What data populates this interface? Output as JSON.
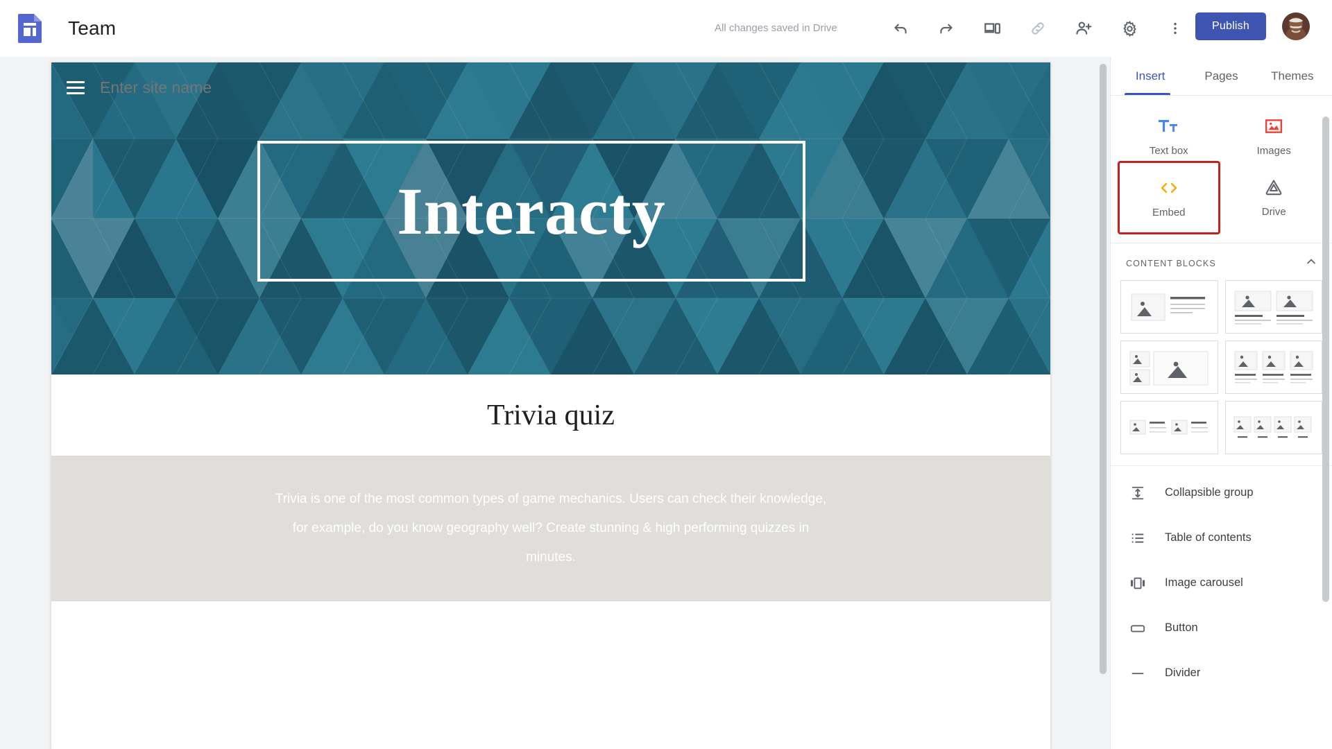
{
  "topbar": {
    "logo_icon": "google-sites-logo-icon",
    "doc_title": "Team",
    "save_status": "All changes saved in Drive",
    "icons": [
      {
        "name": "undo-icon",
        "label": "Undo"
      },
      {
        "name": "redo-icon",
        "label": "Redo"
      },
      {
        "name": "preview-icon",
        "label": "Preview"
      },
      {
        "name": "link-icon",
        "label": "Copy site link"
      },
      {
        "name": "add-person-icon",
        "label": "Share with others"
      },
      {
        "name": "gear-icon",
        "label": "Settings"
      },
      {
        "name": "more-vert-icon",
        "label": "More"
      }
    ],
    "publish_label": "Publish",
    "publish_color": "#4054b2",
    "avatar_name": "user-avatar"
  },
  "canvas": {
    "site_menu_icon": "hamburger-menu-icon",
    "site_name_placeholder": "Enter site name",
    "site_name_value": "",
    "hero_title": "Interacty",
    "hero_bg_color": "#23697f",
    "section_heading": "Trivia quiz",
    "section_body": "Trivia is one of the most common types of game mechanics. Users can check their knowledge, for example, do you know geography well? Create stunning & high performing quizzes in minutes.",
    "section_body_bg": "#e0dedb"
  },
  "panel": {
    "tabs": [
      {
        "label": "Insert",
        "active": true
      },
      {
        "label": "Pages",
        "active": false
      },
      {
        "label": "Themes",
        "active": false
      }
    ],
    "accent_color": "#3b55c4",
    "insert_items": [
      {
        "label": "Text box",
        "icon": "text-box-icon",
        "color": "#4285f4",
        "selected": false
      },
      {
        "label": "Images",
        "icon": "images-icon",
        "color": "#ea4335",
        "selected": false
      },
      {
        "label": "Embed",
        "icon": "embed-code-icon",
        "color": "#f9ab00",
        "selected": true
      },
      {
        "label": "Drive",
        "icon": "drive-icon",
        "color": "#5f6368",
        "selected": false
      }
    ],
    "selection_outline_color": "#c5221f",
    "content_blocks": {
      "title": "CONTENT BLOCKS",
      "collapse_icon": "chevron-up-icon",
      "thumbs": [
        {
          "name": "block-image-left-text-right"
        },
        {
          "name": "block-two-images-with-text"
        },
        {
          "name": "block-two-small-one-large-image"
        },
        {
          "name": "block-three-images-with-text"
        },
        {
          "name": "block-two-small-image-text-pairs"
        },
        {
          "name": "block-four-images-with-captions"
        }
      ]
    },
    "list_items": [
      {
        "label": "Collapsible group",
        "icon": "collapsible-group-icon"
      },
      {
        "label": "Table of contents",
        "icon": "table-of-contents-icon"
      },
      {
        "label": "Image carousel",
        "icon": "image-carousel-icon"
      },
      {
        "label": "Button",
        "icon": "button-icon"
      },
      {
        "label": "Divider",
        "icon": "divider-icon"
      }
    ]
  }
}
